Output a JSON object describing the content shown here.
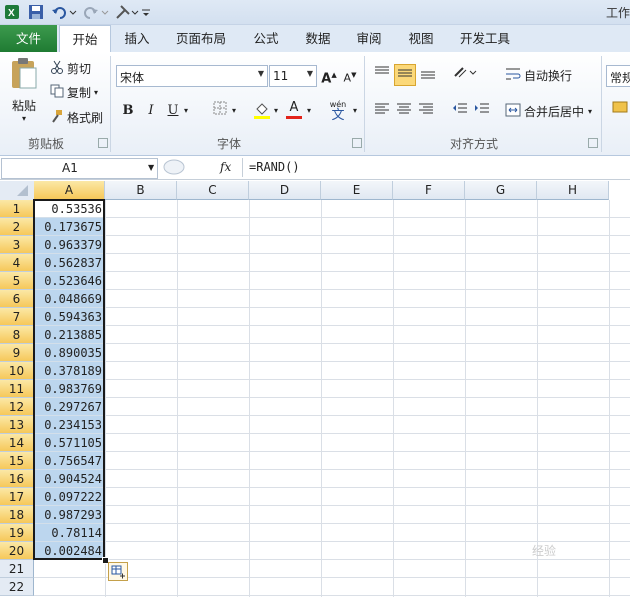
{
  "title_bar": {
    "title": "工作"
  },
  "tabs": [
    "文件",
    "开始",
    "插入",
    "页面布局",
    "公式",
    "数据",
    "审阅",
    "视图",
    "开发工具"
  ],
  "ribbon": {
    "clipboard": {
      "paste": "粘贴",
      "cut": "剪切",
      "copy": "复制",
      "format_painter": "格式刷",
      "group_label": "剪贴板"
    },
    "font": {
      "font_name": "宋体",
      "font_size": "11",
      "bold": "B",
      "italic": "I",
      "underline": "U",
      "grow": "A",
      "shrink": "A",
      "font_color_letter": "A",
      "phonetic": "wén",
      "phonetic_char": "文",
      "group_label": "字体"
    },
    "alignment": {
      "wrap_text": "自动换行",
      "merge_center": "合并后居中",
      "group_label": "对齐方式"
    },
    "number": {
      "format": "常规"
    }
  },
  "formula_bar": {
    "name_box": "A1",
    "fx": "fx",
    "formula": "=RAND()"
  },
  "grid": {
    "columns": [
      "A",
      "B",
      "C",
      "D",
      "E",
      "F",
      "G",
      "H"
    ],
    "rows": [
      "1",
      "2",
      "3",
      "4",
      "5",
      "6",
      "7",
      "8",
      "9",
      "10",
      "11",
      "12",
      "13",
      "14",
      "15",
      "16",
      "17",
      "18",
      "19",
      "20",
      "21",
      "22"
    ],
    "column_a_values": [
      "0.53536",
      "0.173675",
      "0.963379",
      "0.562837",
      "0.523646",
      "0.048669",
      "0.594363",
      "0.213885",
      "0.890035",
      "0.378189",
      "0.983769",
      "0.297267",
      "0.234153",
      "0.571105",
      "0.756547",
      "0.904524",
      "0.097222",
      "0.987293",
      "0.78114",
      "0.002484"
    ]
  },
  "watermark": "经验"
}
